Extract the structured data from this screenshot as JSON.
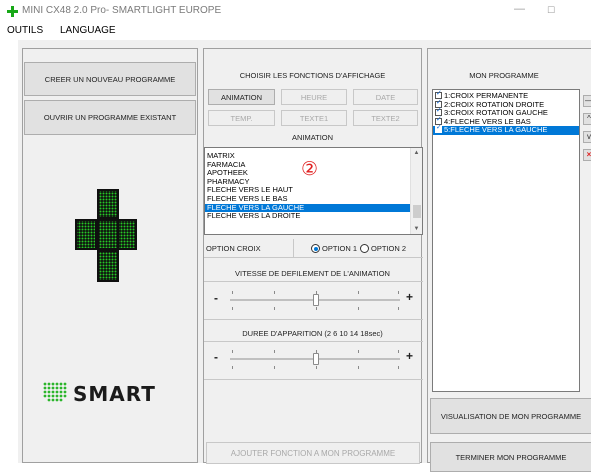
{
  "window": {
    "title": "MINI CX48 2.0 Pro- SMARTLIGHT EUROPE"
  },
  "menu": {
    "items": [
      "OUTILS",
      "LANGUAGE"
    ]
  },
  "left": {
    "create_label": "CREER UN NOUVEAU PROGRAMME",
    "open_label": "OUVRIR UN PROGRAMME EXISTANT",
    "logo_text": "SMART",
    "accent": "#17a817"
  },
  "middle": {
    "header": "CHOISIR LES FONCTIONS D'AFFICHAGE",
    "buttons": {
      "animation": "ANIMATION",
      "heure": "HEURE",
      "date": "DATE",
      "temp": "TEMP.",
      "texte1": "TEXTE1",
      "texte2": "TEXTE2"
    },
    "section_label": "ANIMATION",
    "animation_list": [
      "MATRIX",
      "FARMACIA",
      "APOTHEEK",
      "PHARMACY",
      "FLECHE VERS LE HAUT",
      "FLECHE VERS LE BAS",
      "FLECHE VERS LA GAUCHE",
      "FLECHE VERS LA DROITE"
    ],
    "animation_selected_index": 6,
    "marker": "②",
    "option_croix_label": "OPTION CROIX",
    "option1": "OPTION 1",
    "option2": "OPTION 2",
    "speed_label": "VITESSE DE DEFILEMENT DE L'ANIMATION",
    "duration_label": "DUREE D'APPARITION (2 6 10 14 18sec)",
    "minus": "-",
    "plus": "+",
    "add_label": "AJOUTER FONCTION A MON PROGRAMME"
  },
  "right": {
    "header": "MON PROGRAMME",
    "program_items": [
      "1:CROIX PERMANENTE",
      "2:CROIX ROTATION DROITE",
      "3:CROIX ROTATION GAUCHE",
      "4:FLECHE VERS LE BAS",
      "5:FLECHE VERS LA GAUCHE"
    ],
    "program_selected_index": 4,
    "visualize_label": "VISUALISATION DE MON PROGRAMME",
    "finish_label": "TERMINER MON PROGRAMME",
    "selection_color": "#0078d7"
  }
}
